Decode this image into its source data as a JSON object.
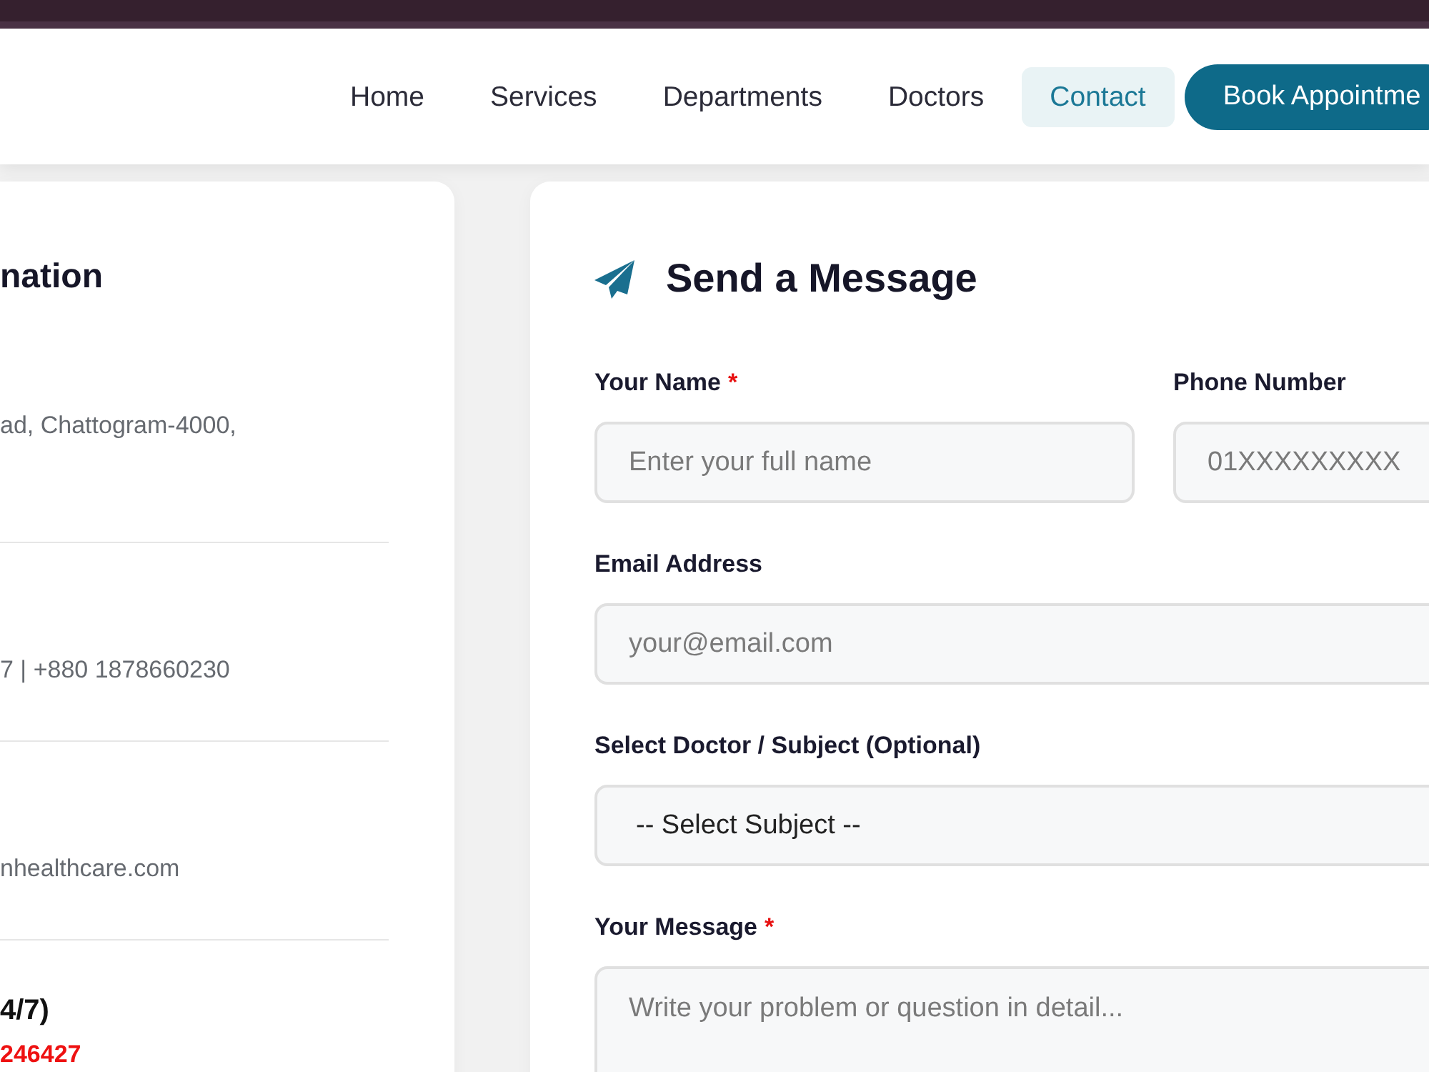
{
  "header": {
    "nav": [
      {
        "label": "Home",
        "selected": false
      },
      {
        "label": "Services",
        "selected": false
      },
      {
        "label": "Departments",
        "selected": false
      },
      {
        "label": "Doctors",
        "selected": false
      },
      {
        "label": "Contact",
        "selected": true
      }
    ],
    "cta": "Book Appointme"
  },
  "info_card": {
    "title": "nation",
    "items": [
      {
        "kind": "text",
        "text": "ad, Chattogram-4000,"
      },
      {
        "kind": "text",
        "text": "7 | +880 1878660230"
      },
      {
        "kind": "text",
        "text": "nhealthcare.com"
      },
      {
        "kind": "hotline",
        "heading": "4/7)",
        "number": "246427"
      }
    ]
  },
  "form": {
    "title": "Send a Message",
    "fields": [
      {
        "kind": "input",
        "label": "Your Name",
        "mark": "*",
        "placeholder": "Enter your full name"
      },
      {
        "kind": "input",
        "label": "Phone Number",
        "placeholder": "01XXXXXXXXX"
      },
      {
        "kind": "input",
        "label": "Email Address",
        "placeholder": "your@email.com"
      },
      {
        "kind": "select",
        "label": "Select Doctor / Subject (Optional)",
        "value": "-- Select Subject --"
      },
      {
        "kind": "textarea",
        "label": "Your Message",
        "mark": "*",
        "placeholder": "Write your problem or question in detail..."
      }
    ]
  }
}
